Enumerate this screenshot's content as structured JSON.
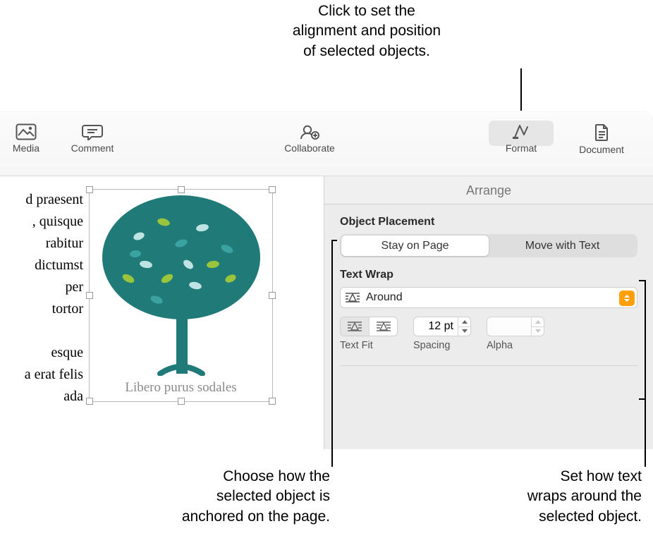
{
  "callouts": {
    "top": "Click to set the\nalignment and position\nof selected objects.",
    "bottom_left": "Choose how the\nselected object is\nanchored on the page.",
    "bottom_right": "Set how text\nwraps around the\nselected object."
  },
  "toolbar": {
    "media": "Media",
    "comment": "Comment",
    "collaborate": "Collaborate",
    "format": "Format",
    "document": "Document"
  },
  "document": {
    "para1": "d praesent\n, quisque\nrabitur\ndictumst\nper\ntortor",
    "para2": "esque\na erat felis\nada",
    "caption": "Libero purus sodales"
  },
  "inspector": {
    "tab": "Arrange",
    "object_placement": {
      "heading": "Object Placement",
      "stay": "Stay on Page",
      "move": "Move with Text"
    },
    "text_wrap": {
      "heading": "Text Wrap",
      "mode": "Around",
      "text_fit_label": "Text Fit",
      "spacing_label": "Spacing",
      "spacing_value": "12 pt",
      "alpha_label": "Alpha"
    }
  }
}
